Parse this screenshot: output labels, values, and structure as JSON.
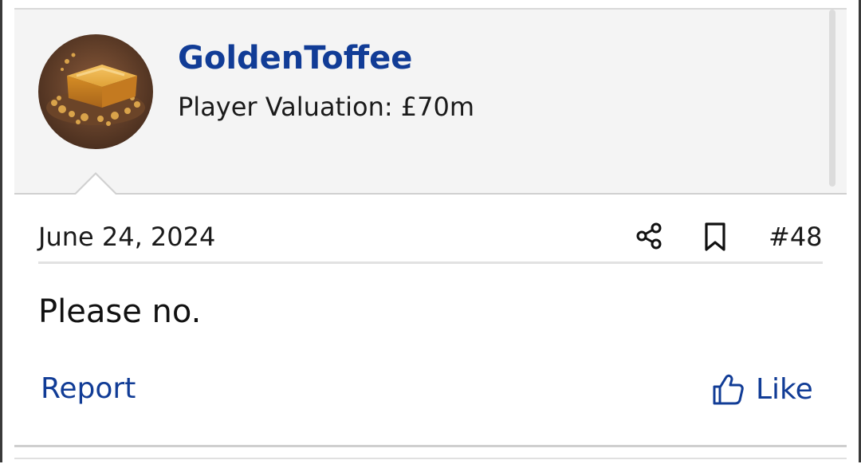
{
  "post": {
    "username": "GoldenToffee",
    "valuation": "Player Valuation: £70m",
    "avatar": "toffee-avatar",
    "date": "June 24, 2024",
    "number": "#48",
    "message": "Please no.",
    "actions": {
      "share_icon": "share-icon",
      "bookmark_icon": "bookmark-icon",
      "report_label": "Report",
      "like_label": "Like",
      "like_icon": "thumbs-up-icon"
    }
  },
  "colors": {
    "link": "#113c96",
    "user_block_bg": "#f4f4f4",
    "text": "#1a1a1a"
  }
}
